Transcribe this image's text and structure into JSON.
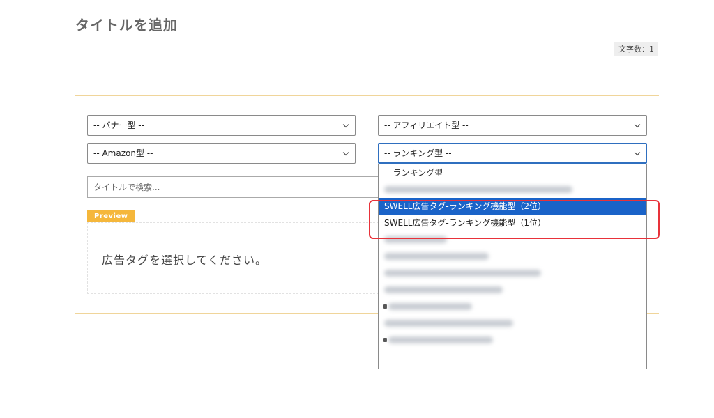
{
  "header": {
    "title": "タイトルを追加",
    "char_count": "文字数：1"
  },
  "filters": {
    "banner": "-- バナー型 --",
    "affiliate": "-- アフィリエイト型 --",
    "amazon": "-- Amazon型 --",
    "ranking": "-- ランキング型 --"
  },
  "search": {
    "placeholder": "タイトルで検索..."
  },
  "preview": {
    "tag": "Preview",
    "message": "広告タグを選択してください。"
  },
  "ranking_dropdown": {
    "options": [
      "-- ランキング型 --",
      "SWELL広告タグ-ランキング機能型（2位）",
      "SWELL広告タグ-ランキング機能型（1位）"
    ],
    "selected_index": 1
  },
  "colors": {
    "accent_line": "#f0d59a",
    "preview_tag": "#f5b73b",
    "selected_option": "#1a63c8",
    "highlight": "#e8323a"
  }
}
